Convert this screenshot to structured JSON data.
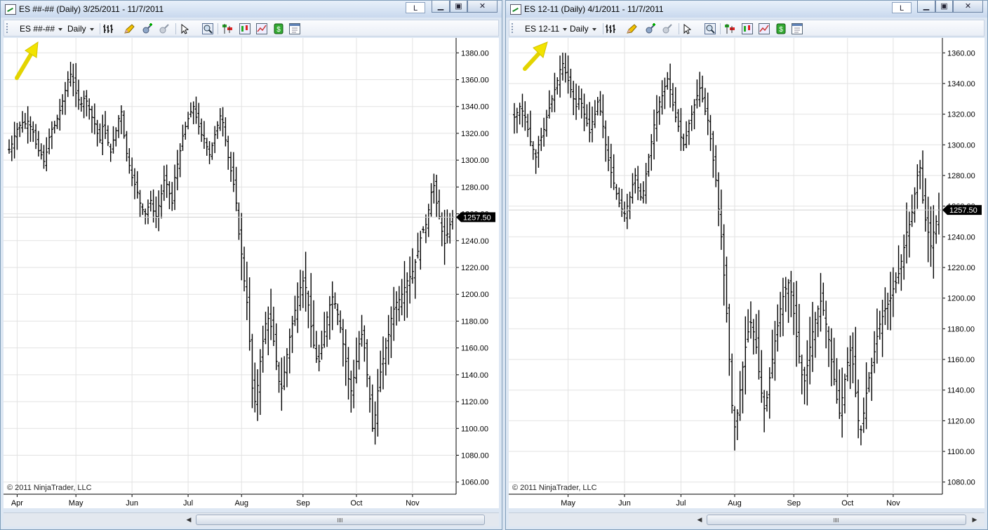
{
  "windows": [
    {
      "title": "ES ##-## (Daily)  3/25/2011 - 11/7/2011",
      "instrument": "ES ##-##",
      "interval": "Daily",
      "l_button": "L",
      "copyright": "© 2011 NinjaTrader, LLC",
      "price_marker": "1257.50",
      "chart_data": {
        "type": "ohlc",
        "x_tick_labels": [
          "Apr",
          "May",
          "Jun",
          "Jul",
          "Aug",
          "Sep",
          "Oct",
          "Nov"
        ],
        "x_tick_index": [
          3,
          25,
          46,
          67,
          87,
          110,
          130,
          151
        ],
        "y_tick_labels": [
          "1060.00",
          "1080.00",
          "1100.00",
          "1120.00",
          "1140.00",
          "1160.00",
          "1180.00",
          "1200.00",
          "1220.00",
          "1240.00",
          "1260.00",
          "1280.00",
          "1300.00",
          "1320.00",
          "1340.00",
          "1360.00",
          "1380.00"
        ],
        "ylim": [
          1052,
          1388
        ],
        "last_price": 1257.5,
        "grid": true,
        "series_close": [
          1308,
          1312,
          1318,
          1323,
          1326,
          1328,
          1327,
          1329,
          1325,
          1321,
          1312,
          1307,
          1304,
          1299,
          1306,
          1317,
          1323,
          1326,
          1331,
          1337,
          1344,
          1352,
          1360,
          1364,
          1358,
          1350,
          1345,
          1342,
          1346,
          1344,
          1338,
          1332,
          1327,
          1320,
          1315,
          1325,
          1320,
          1313,
          1306,
          1315,
          1322,
          1331,
          1336,
          1318,
          1305,
          1296,
          1287,
          1282,
          1276,
          1268,
          1263,
          1260,
          1265,
          1270,
          1262,
          1258,
          1266,
          1275,
          1285,
          1282,
          1275,
          1268,
          1287,
          1297,
          1307,
          1318,
          1325,
          1331,
          1336,
          1340,
          1332,
          1325,
          1319,
          1316,
          1310,
          1304,
          1311,
          1319,
          1326,
          1333,
          1328,
          1315,
          1302,
          1292,
          1282,
          1268,
          1245,
          1230,
          1210,
          1194,
          1165,
          1130,
          1120,
          1132,
          1150,
          1165,
          1178,
          1182,
          1176,
          1165,
          1150,
          1135,
          1130,
          1142,
          1155,
          1168,
          1178,
          1188,
          1198,
          1205,
          1210,
          1205,
          1192,
          1176,
          1162,
          1152,
          1150,
          1160,
          1172,
          1183,
          1192,
          1198,
          1193,
          1185,
          1175,
          1163,
          1150,
          1137,
          1128,
          1138,
          1150,
          1163,
          1170,
          1160,
          1140,
          1122,
          1100,
          1110,
          1128,
          1142,
          1152,
          1160,
          1170,
          1182,
          1189,
          1194,
          1196,
          1200,
          1205,
          1210,
          1213,
          1217,
          1224,
          1232,
          1242,
          1248,
          1252,
          1263,
          1276,
          1281,
          1268,
          1258,
          1247,
          1238,
          1245,
          1252,
          1257.5
        ]
      }
    },
    {
      "title": "ES 12-11 (Daily)  4/1/2011 - 11/7/2011",
      "instrument": "ES 12-11",
      "interval": "Daily",
      "l_button": "L",
      "copyright": "© 2011 NinjaTrader, LLC",
      "price_marker": "1257.50",
      "chart_data": {
        "type": "ohlc",
        "x_tick_labels": [
          "May",
          "Jun",
          "Jul",
          "Aug",
          "Sep",
          "Oct",
          "Nov"
        ],
        "x_tick_index": [
          20,
          41,
          62,
          82,
          104,
          124,
          141
        ],
        "y_tick_labels": [
          "1080.00",
          "1100.00",
          "1120.00",
          "1140.00",
          "1160.00",
          "1180.00",
          "1200.00",
          "1220.00",
          "1240.00",
          "1260.00",
          "1280.00",
          "1300.00",
          "1320.00",
          "1340.00",
          "1360.00"
        ],
        "ylim": [
          1073,
          1367
        ],
        "last_price": 1257.5,
        "grid": true,
        "series_close": [
          1318,
          1321,
          1325,
          1322,
          1318,
          1310,
          1302,
          1297,
          1292,
          1300,
          1305,
          1310,
          1318,
          1324,
          1330,
          1336,
          1342,
          1349,
          1353,
          1347,
          1342,
          1336,
          1330,
          1325,
          1330,
          1327,
          1320,
          1314,
          1308,
          1315,
          1320,
          1328,
          1322,
          1312,
          1300,
          1290,
          1282,
          1275,
          1268,
          1262,
          1258,
          1255,
          1260,
          1266,
          1274,
          1280,
          1272,
          1266,
          1270,
          1281,
          1292,
          1302,
          1313,
          1321,
          1328,
          1332,
          1338,
          1343,
          1336,
          1326,
          1318,
          1312,
          1305,
          1300,
          1306,
          1314,
          1320,
          1326,
          1332,
          1337,
          1330,
          1322,
          1316,
          1304,
          1290,
          1277,
          1258,
          1240,
          1215,
          1190,
          1160,
          1130,
          1116,
          1125,
          1140,
          1155,
          1168,
          1178,
          1184,
          1178,
          1168,
          1152,
          1138,
          1128,
          1135,
          1148,
          1160,
          1172,
          1182,
          1193,
          1201,
          1206,
          1210,
          1204,
          1190,
          1175,
          1162,
          1150,
          1146,
          1156,
          1168,
          1178,
          1186,
          1193,
          1198,
          1192,
          1183,
          1173,
          1160,
          1147,
          1134,
          1125,
          1135,
          1147,
          1158,
          1166,
          1157,
          1138,
          1120,
          1114,
          1125,
          1138,
          1148,
          1156,
          1165,
          1175,
          1183,
          1188,
          1193,
          1196,
          1200,
          1206,
          1210,
          1216,
          1224,
          1233,
          1243,
          1248,
          1256,
          1268,
          1280,
          1285,
          1264,
          1251,
          1243,
          1234,
          1243,
          1250,
          1257.5
        ]
      }
    }
  ]
}
